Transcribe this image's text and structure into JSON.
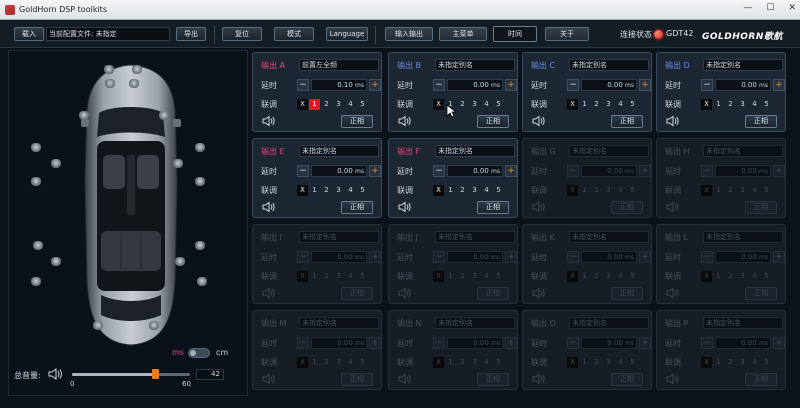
{
  "window": {
    "title": "GoldHorn DSP toolkits"
  },
  "toolbar": {
    "load": "载入",
    "config_file_label": "当前配置文件: 未指定",
    "export": "导出",
    "reset": "复位",
    "mode": "模式",
    "language": "Language",
    "tabs": [
      "输入输出",
      "主菜单",
      "时间",
      "关于"
    ],
    "active_tab": "时间",
    "connection_label": "连接状态",
    "connection_color": "#d41a0c",
    "model": "GDT42",
    "logo": "GOLDHORN歌航"
  },
  "left": {
    "unit_ms": "ms",
    "unit_cm": "cm",
    "master_label": "总音量:",
    "volume": {
      "value": "42",
      "min": "0",
      "max": "60",
      "level": 42
    }
  },
  "channels": [
    {
      "name": "输出 A",
      "name_color": "#e0457a",
      "alias": "前置左全频",
      "delay": "0.10",
      "unit": "ms",
      "link_sel": 1,
      "enabled": true
    },
    {
      "name": "输出 B",
      "name_color": "#6d8bd9",
      "alias": "未指定别名",
      "delay": "0.00",
      "unit": "ms",
      "link_sel": 0,
      "enabled": true
    },
    {
      "name": "输出 C",
      "name_color": "#6d8bd9",
      "alias": "未指定别名",
      "delay": "0.00",
      "unit": "ms",
      "link_sel": 0,
      "enabled": true
    },
    {
      "name": "输出 D",
      "name_color": "#6d8bd9",
      "alias": "未指定别名",
      "delay": "0.00",
      "unit": "ms",
      "link_sel": 0,
      "enabled": true
    },
    {
      "name": "输出 E",
      "name_color": "#e0457a",
      "alias": "未指定别名",
      "delay": "0.00",
      "unit": "ms",
      "link_sel": 0,
      "enabled": true
    },
    {
      "name": "输出 F",
      "name_color": "#e0457a",
      "alias": "未指定别名",
      "delay": "0.00",
      "unit": "ms",
      "link_sel": 0,
      "enabled": true
    },
    {
      "name": "输出 G",
      "alias": "未指定别名",
      "delay": "0.00",
      "unit": "ms",
      "link_sel": 0,
      "enabled": false
    },
    {
      "name": "输出 H",
      "alias": "未指定别名",
      "delay": "0.00",
      "unit": "ms",
      "link_sel": 0,
      "enabled": false
    },
    {
      "name": "输出 I",
      "alias": "未指定别名",
      "delay": "0.00",
      "unit": "ms",
      "link_sel": 0,
      "enabled": false
    },
    {
      "name": "输出 J",
      "alias": "未指定别名",
      "delay": "0.00",
      "unit": "ms",
      "link_sel": 0,
      "enabled": false
    },
    {
      "name": "输出 K",
      "alias": "未指定别名",
      "delay": "0.00",
      "unit": "ms",
      "link_sel": 0,
      "enabled": false
    },
    {
      "name": "输出 L",
      "alias": "未指定别名",
      "delay": "0.00",
      "unit": "ms",
      "link_sel": 0,
      "enabled": false
    },
    {
      "name": "输出 M",
      "alias": "未指定别名",
      "delay": "0.00",
      "unit": "ms",
      "link_sel": 0,
      "enabled": false
    },
    {
      "name": "输出 N",
      "alias": "未指定别名",
      "delay": "0.00",
      "unit": "ms",
      "link_sel": 0,
      "enabled": false
    },
    {
      "name": "输出 O",
      "alias": "未指定别名",
      "delay": "0.00",
      "unit": "ms",
      "link_sel": 0,
      "enabled": false
    },
    {
      "name": "输出 P",
      "alias": "未指定别名",
      "delay": "0.00",
      "unit": "ms",
      "link_sel": 0,
      "enabled": false
    }
  ],
  "channel_labels": {
    "delay": "延时",
    "link": "联调",
    "phase": "正相",
    "minus": "−",
    "plus": "+",
    "link_x": "X",
    "link_nums": [
      "1",
      "2",
      "3",
      "4",
      "5"
    ]
  }
}
